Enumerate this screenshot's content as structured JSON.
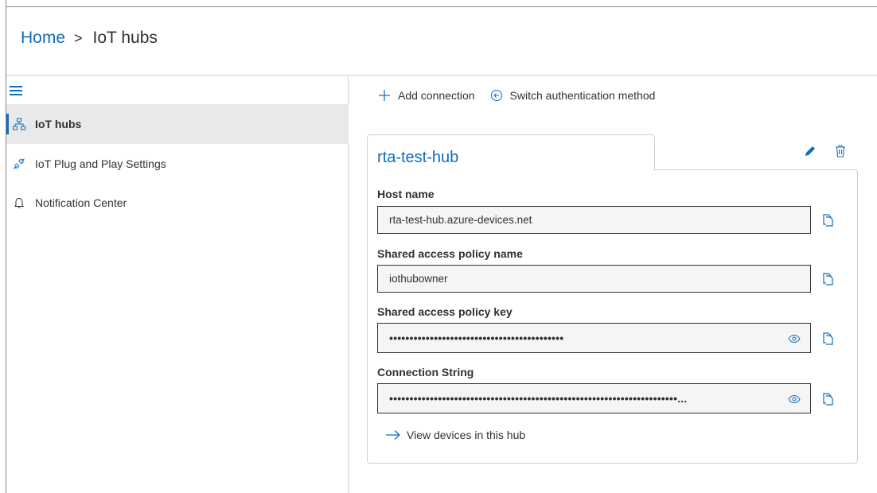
{
  "breadcrumb": {
    "home": "Home",
    "separator": ">",
    "current": "IoT hubs"
  },
  "sidebar": {
    "menu_icon": "hamburger-icon",
    "items": [
      {
        "label": "IoT hubs",
        "icon": "hub-network-icon",
        "selected": true
      },
      {
        "label": "IoT Plug and Play Settings",
        "icon": "plug-icon",
        "selected": false
      },
      {
        "label": "Notification Center",
        "icon": "bell-icon",
        "selected": false
      }
    ]
  },
  "toolbar": {
    "add_label": "Add connection",
    "switch_label": "Switch authentication method"
  },
  "hub": {
    "name": "rta-test-hub",
    "fields": [
      {
        "label": "Host name",
        "value": "rta-test-hub.azure-devices.net"
      },
      {
        "label": "Shared access policy name",
        "value": "iothubowner"
      },
      {
        "label": "Shared access policy key",
        "value": "•••••••••••••••••••••••••••••••••••••••••••"
      },
      {
        "label": "Connection String",
        "value": "•••••••••••••••••••••••••••••••••••••••••••••••••••••••••••••••••••••••..."
      }
    ],
    "view_devices_label": "View devices in this hub"
  },
  "colors": {
    "accent": "#0f6cbd",
    "selected_bg": "#e9e9e9",
    "border": "#d2d0ce",
    "field_bg": "#f5f5f5"
  }
}
